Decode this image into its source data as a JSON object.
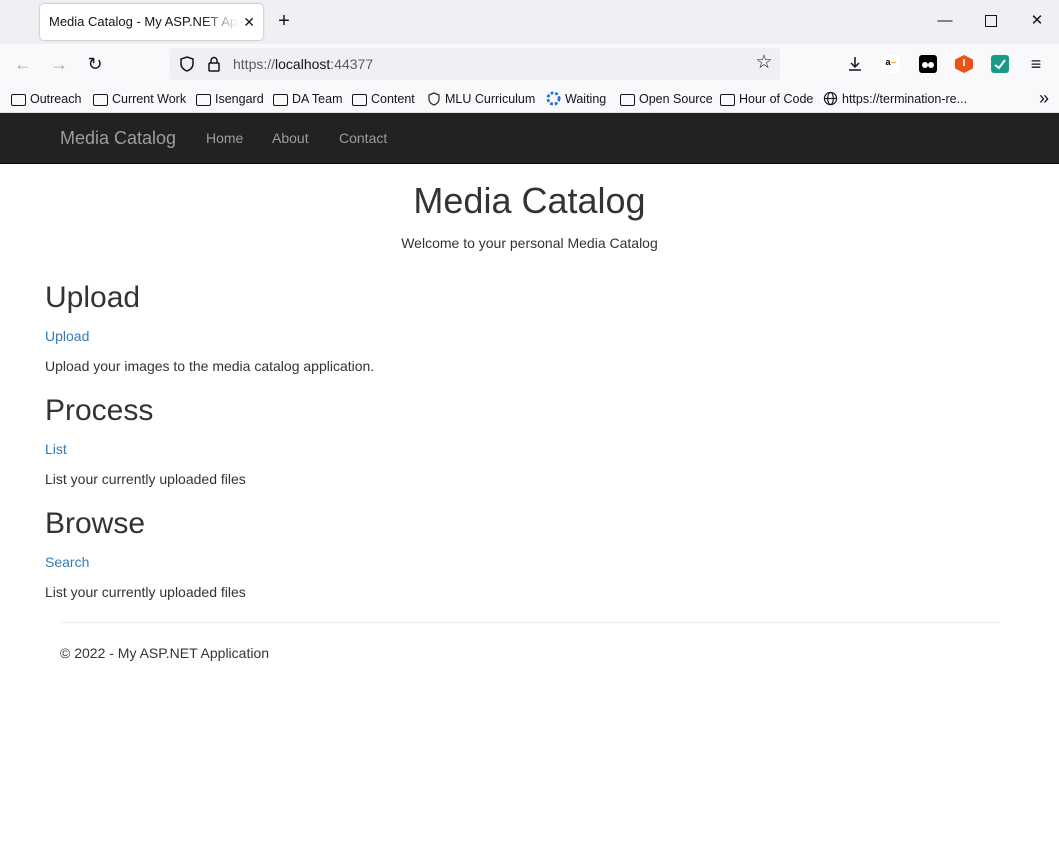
{
  "browser": {
    "tab_title": "Media Catalog - My ASP.NET Application",
    "url_scheme": "https://",
    "url_host": "localhost",
    "url_port": ":44377",
    "bookmarks": [
      {
        "label": "Outreach",
        "icon": "folder-icon"
      },
      {
        "label": "Current Work",
        "icon": "folder-icon"
      },
      {
        "label": "Isengard",
        "icon": "folder-icon"
      },
      {
        "label": "DA Team",
        "icon": "folder-icon"
      },
      {
        "label": "Content",
        "icon": "folder-icon"
      },
      {
        "label": "MLU Curriculum",
        "icon": "shield-icon"
      },
      {
        "label": "Waiting",
        "icon": "spinner-icon"
      },
      {
        "label": "Open Source",
        "icon": "folder-icon"
      },
      {
        "label": "Hour of Code",
        "icon": "folder-icon"
      },
      {
        "label": "https://termination-re...",
        "icon": "globe-icon"
      }
    ]
  },
  "site": {
    "brand": "Media Catalog",
    "nav": [
      "Home",
      "About",
      "Contact"
    ],
    "title": "Media Catalog",
    "subtitle": "Welcome to your personal Media Catalog",
    "sections": [
      {
        "heading": "Upload",
        "link": "Upload",
        "text": "Upload your images to the media catalog application."
      },
      {
        "heading": "Process",
        "link": "List",
        "text": "List your currently uploaded files"
      },
      {
        "heading": "Browse",
        "link": "Search",
        "text": "List your currently uploaded files"
      }
    ],
    "footer": "© 2022 - My ASP.NET Application"
  },
  "colors": {
    "navbar_bg": "#222222",
    "navbar_text": "#9d9d9d",
    "link": "#337ab7",
    "text": "#333333"
  }
}
